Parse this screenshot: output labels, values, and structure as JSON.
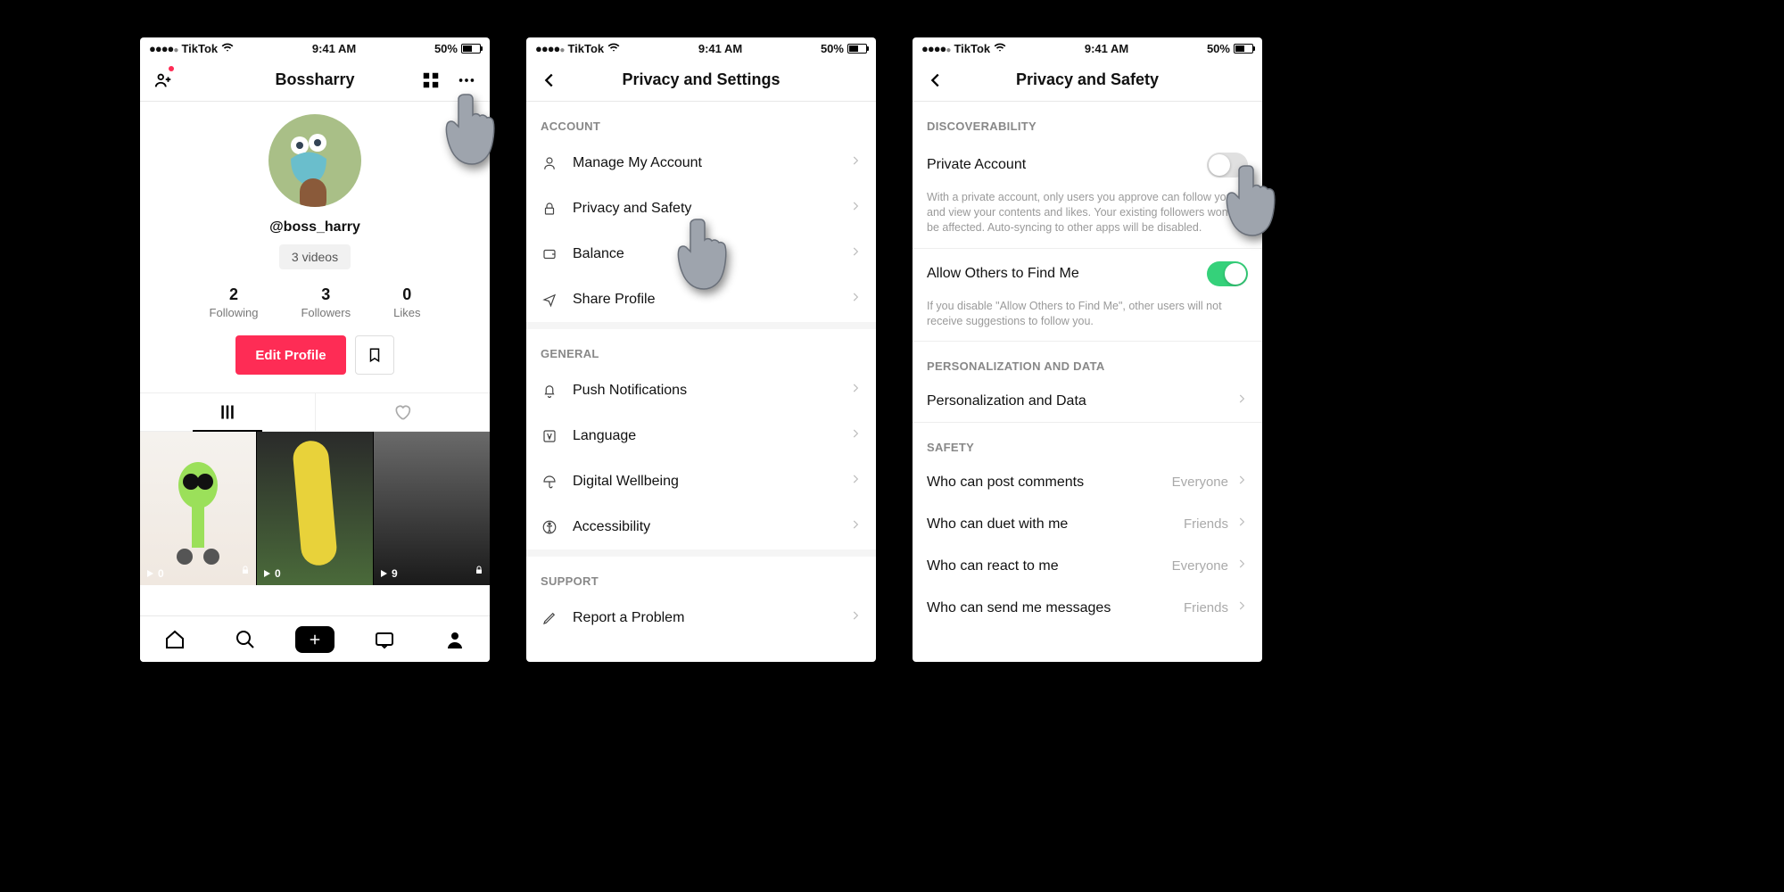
{
  "status": {
    "carrier": "TikTok",
    "time": "9:41 AM",
    "battery": "50%"
  },
  "screen1": {
    "title": "Bossharry",
    "handle": "@boss_harry",
    "video_count": "3 videos",
    "stats": {
      "following": {
        "n": "2",
        "l": "Following"
      },
      "followers": {
        "n": "3",
        "l": "Followers"
      },
      "likes": {
        "n": "0",
        "l": "Likes"
      }
    },
    "edit_label": "Edit Profile",
    "videos": [
      {
        "views": "0",
        "locked": true
      },
      {
        "views": "0",
        "locked": false
      },
      {
        "views": "9",
        "locked": true
      }
    ]
  },
  "screen2": {
    "title": "Privacy and Settings",
    "sections": {
      "account_h": "ACCOUNT",
      "account": [
        "Manage My Account",
        "Privacy and Safety",
        "Balance",
        "Share Profile"
      ],
      "general_h": "GENERAL",
      "general": [
        "Push Notifications",
        "Language",
        "Digital Wellbeing",
        "Accessibility"
      ],
      "support_h": "SUPPORT",
      "support": [
        "Report a Problem"
      ]
    }
  },
  "screen3": {
    "title": "Privacy and Safety",
    "disc_h": "DISCOVERABILITY",
    "private_label": "Private Account",
    "private_desc": "With a private account, only users you approve can follow you and view your contents and likes. Your existing followers won't be affected. Auto-syncing to other apps will be disabled.",
    "findme_label": "Allow Others to Find Me",
    "findme_desc": "If you disable \"Allow Others to Find Me\", other users will not receive suggestions to follow you.",
    "pers_h": "PERSONALIZATION AND DATA",
    "pers_row": "Personalization and Data",
    "safety_h": "SAFETY",
    "safety": [
      {
        "l": "Who can post comments",
        "v": "Everyone"
      },
      {
        "l": "Who can duet with me",
        "v": "Friends"
      },
      {
        "l": "Who can react to me",
        "v": "Everyone"
      },
      {
        "l": "Who can send me messages",
        "v": "Friends"
      }
    ]
  }
}
